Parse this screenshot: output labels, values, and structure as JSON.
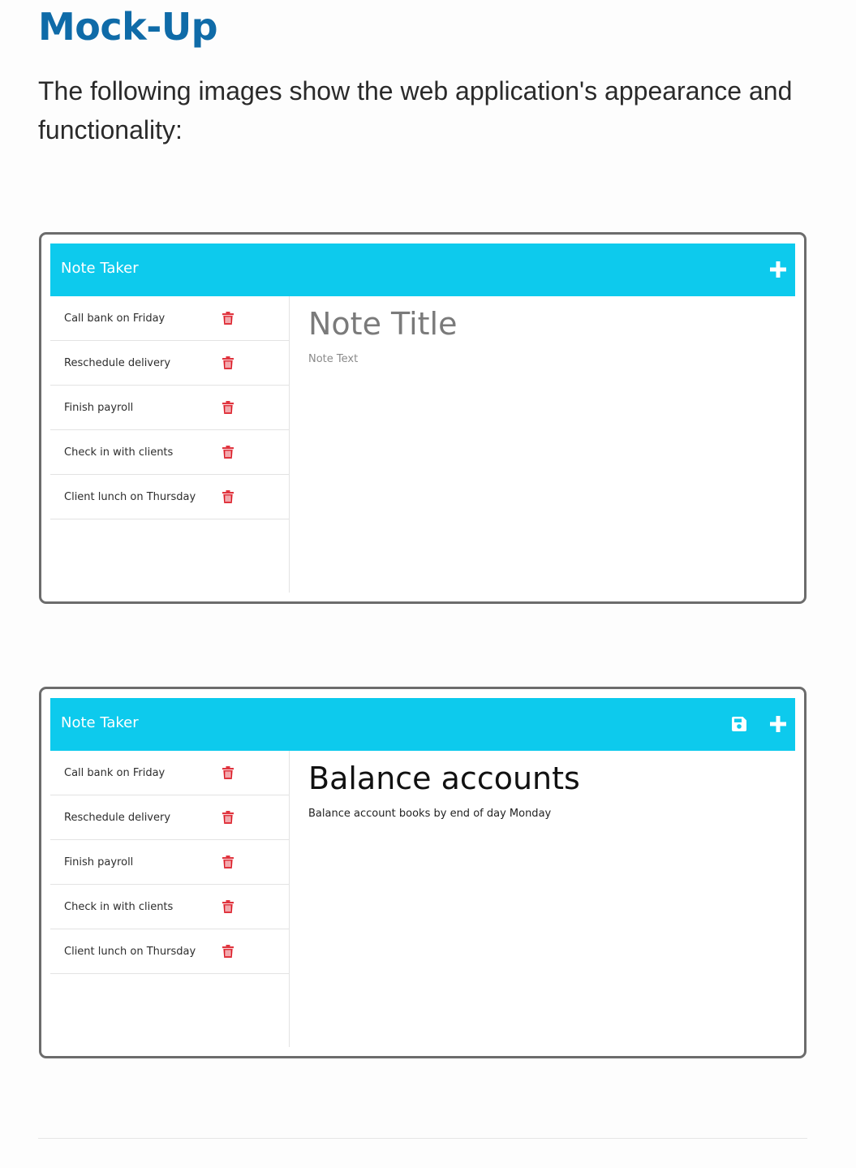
{
  "page": {
    "heading": "Mock-Up",
    "intro": "The following images show the web application's appearance and functionality:"
  },
  "colors": {
    "heading": "#0f6ba8",
    "navbar": "#0dcaed",
    "trash_icon": "#e0353f"
  },
  "mockups": [
    {
      "navbar": {
        "brand": "Note Taker",
        "icons": [
          "plus-icon"
        ]
      },
      "notes": [
        {
          "title": "Call bank on Friday"
        },
        {
          "title": "Reschedule delivery"
        },
        {
          "title": "Finish payroll"
        },
        {
          "title": "Check in with clients"
        },
        {
          "title": "Client lunch on Thursday"
        }
      ],
      "editor": {
        "title_placeholder": "Note Title",
        "text_placeholder": "Note Text"
      }
    },
    {
      "navbar": {
        "brand": "Note Taker",
        "icons": [
          "save-icon",
          "plus-icon"
        ]
      },
      "notes": [
        {
          "title": "Call bank on Friday"
        },
        {
          "title": "Reschedule delivery"
        },
        {
          "title": "Finish payroll"
        },
        {
          "title": "Check in with clients"
        },
        {
          "title": "Client lunch on Thursday"
        }
      ],
      "editor": {
        "title": "Balance accounts",
        "text": "Balance account books by end of day Monday"
      }
    }
  ]
}
